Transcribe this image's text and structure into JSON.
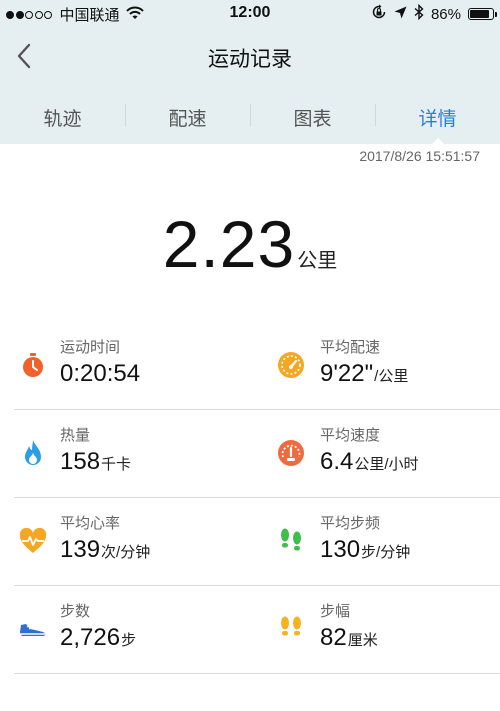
{
  "status_bar": {
    "carrier": "中国联通",
    "time": "12:00",
    "battery_percent": "86%",
    "battery_level": 0.86
  },
  "nav": {
    "title": "运动记录"
  },
  "tabs": [
    {
      "label": "轨迹",
      "active": false
    },
    {
      "label": "配速",
      "active": false
    },
    {
      "label": "图表",
      "active": false
    },
    {
      "label": "详情",
      "active": true
    }
  ],
  "timestamp": "2017/8/26 15:51:57",
  "distance": {
    "value": "2.23",
    "unit": "公里"
  },
  "stats": {
    "duration": {
      "label": "运动时间",
      "value": "0:20:54",
      "unit": ""
    },
    "avg_pace": {
      "label": "平均配速",
      "value": "9'22\"",
      "unit": "/公里"
    },
    "calories": {
      "label": "热量",
      "value": "158",
      "unit": "千卡"
    },
    "avg_speed": {
      "label": "平均速度",
      "value": "6.4",
      "unit": "公里/小时"
    },
    "avg_heart_rate": {
      "label": "平均心率",
      "value": "139",
      "unit": "次/分钟"
    },
    "avg_cadence": {
      "label": "平均步频",
      "value": "130",
      "unit": "步/分钟"
    },
    "steps": {
      "label": "步数",
      "value": "2,726",
      "unit": "步"
    },
    "stride": {
      "label": "步幅",
      "value": "82",
      "unit": "厘米"
    }
  },
  "colors": {
    "accent_blue": "#2a7fd4",
    "header_bg": "#e5eef0",
    "timer_orange": "#f0622a",
    "pace_orange": "#f5a623",
    "speed_orange": "#ef6a3c",
    "fire_blue": "#2b9fe6",
    "heart_orange": "#f5a623",
    "footprint_green": "#3fbf4a",
    "shoe_blue": "#2f6fd1",
    "footprint_yellow": "#f5b31f"
  }
}
